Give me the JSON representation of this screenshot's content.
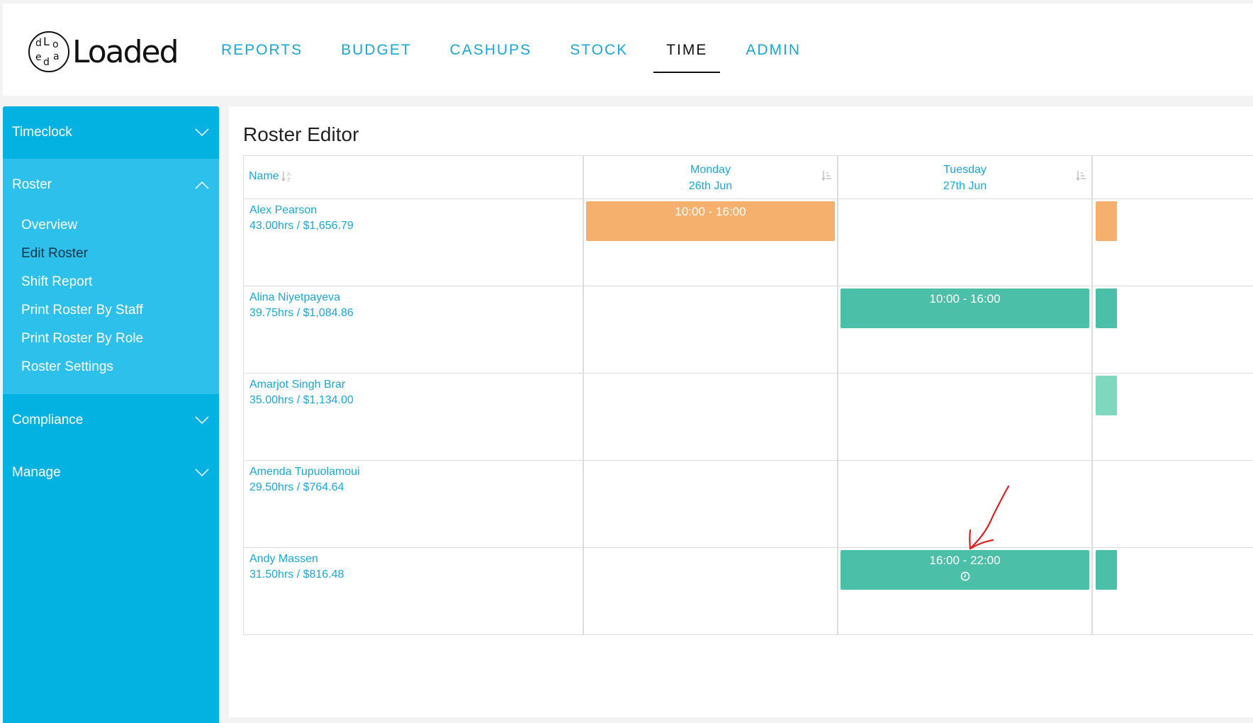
{
  "brand": {
    "name": "Loaded",
    "mark_letters": [
      "d",
      "L",
      "o",
      "e",
      "d",
      "a"
    ]
  },
  "nav": [
    {
      "label": "REPORTS",
      "active": false
    },
    {
      "label": "BUDGET",
      "active": false
    },
    {
      "label": "CASHUPS",
      "active": false
    },
    {
      "label": "STOCK",
      "active": false
    },
    {
      "label": "TIME",
      "active": true
    },
    {
      "label": "ADMIN",
      "active": false
    }
  ],
  "sidebar": {
    "timeclock": "Timeclock",
    "roster": "Roster",
    "roster_items": [
      "Overview",
      "Edit Roster",
      "Shift Report",
      "Print Roster By Staff",
      "Print Roster By Role",
      "Roster Settings"
    ],
    "current_item": "Edit Roster",
    "compliance": "Compliance",
    "manage": "Manage"
  },
  "page": {
    "title": "Roster Editor"
  },
  "grid": {
    "name_header": "Name",
    "days": [
      {
        "day": "Monday",
        "date": "26th Jun"
      },
      {
        "day": "Tuesday",
        "date": "27th Jun"
      }
    ],
    "staff": [
      {
        "name": "Alex Pearson",
        "summary": "43.00hrs / $1,656.79",
        "monday": "10:00 - 16:00",
        "tuesday": ""
      },
      {
        "name": "Alina Niyetpayeva",
        "summary": "39.75hrs / $1,084.86",
        "monday": "",
        "tuesday": "10:00 - 16:00"
      },
      {
        "name": "Amarjot Singh Brar",
        "summary": "35.00hrs / $1,134.00",
        "monday": "",
        "tuesday": ""
      },
      {
        "name": "Amenda Tupuolamoui",
        "summary": "29.50hrs / $764.64",
        "monday": "",
        "tuesday": ""
      },
      {
        "name": "Andy Massen",
        "summary": "31.50hrs / $816.48",
        "monday": "",
        "tuesday": "16:00 - 22:00"
      }
    ]
  },
  "colors": {
    "accent": "#1aa7d6",
    "sidebar": "#04b2e2",
    "sidebar_open": "#2cc0ea",
    "shift_orange": "#f5b06d",
    "shift_teal": "#4bbfa7",
    "annotation": "#e02020"
  },
  "icons": {
    "section_collapsed": "chevron-down-icon",
    "section_expanded": "chevron-up-icon",
    "sort": "sort-icon",
    "shift_timer": "clock-icon"
  }
}
